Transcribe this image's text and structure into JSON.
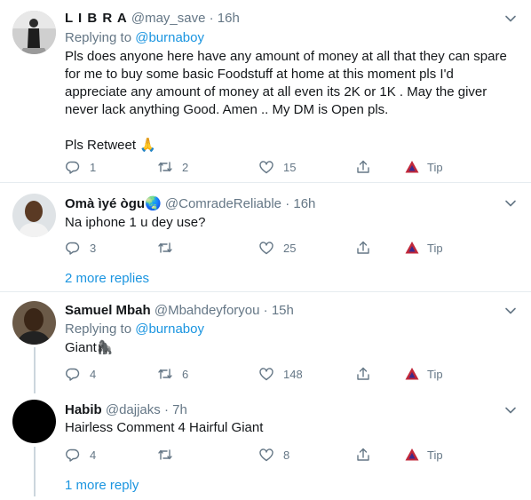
{
  "tweets": [
    {
      "name": "L I B R A",
      "handle": "@may_save",
      "sep": "·",
      "time": "16h",
      "replying_prefix": "Replying to",
      "replying_to": "@burnaboy",
      "text_lines": [
        "Pls does anyone here have any amount of money at all that they can spare",
        "for me to buy some basic Foodstuff at home at this moment pls I'd",
        "appreciate any amount of money at all even its 2K or 1K  . May the giver",
        "never lack anything Good. Amen .. My DM is Open pls."
      ],
      "text_last": "Pls Retweet",
      "emoji": "🙏",
      "replies": "1",
      "retweets": "2",
      "likes": "15",
      "tip": "Tip"
    },
    {
      "name": "Omà ìyé ògu",
      "emoji": "🌏",
      "handle": "@ComradeReliable",
      "sep": "·",
      "time": "16h",
      "text": "Na iphone 1 u dey use?",
      "replies": "3",
      "retweets": "",
      "likes": "25",
      "tip": "Tip"
    },
    {
      "name": "Samuel Mbah",
      "handle": "@Mbahdeyforyou",
      "sep": "·",
      "time": "15h",
      "replying_prefix": "Replying to",
      "replying_to": "@burnaboy",
      "text": "Giant",
      "emoji": "🦍",
      "replies": "4",
      "retweets": "6",
      "likes": "148",
      "tip": "Tip"
    },
    {
      "name": "Habib",
      "handle": "@dajjaks",
      "sep": "·",
      "time": "7h",
      "text": "Hairless Comment 4 Hairful Giant",
      "replies": "4",
      "retweets": "",
      "likes": "8",
      "tip": "Tip"
    }
  ],
  "more_replies_1": "2 more replies",
  "more_replies_2": "1 more reply",
  "colors": {
    "accent": "#1b95e0",
    "muted": "#657786",
    "text": "#14171a",
    "divider": "#e6ecf0"
  },
  "icons": [
    "chevron-down-icon",
    "reply-icon",
    "retweet-icon",
    "like-icon",
    "share-icon",
    "tip-icon"
  ]
}
